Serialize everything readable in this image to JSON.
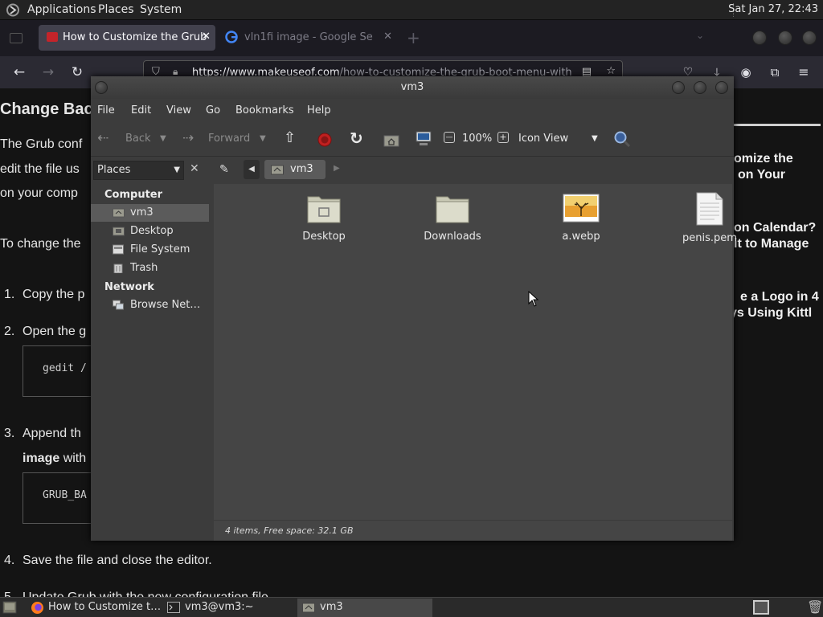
{
  "top_panel": {
    "menus": [
      "Applications",
      "Places",
      "System"
    ],
    "clock": "Sat Jan 27, 22:43"
  },
  "browser": {
    "tabs": [
      {
        "label": "How to Customize the Grub",
        "active": true
      },
      {
        "label": "vln1fi image - Google Se",
        "active": false
      }
    ],
    "url_domain": "https://www.makeuseof.com",
    "url_path": "/how-to-customize-the-grub-boot-menu-with",
    "page": {
      "heading": "Change Bac",
      "para_lines": [
        "The Grub conf",
        "edit the file us",
        "on your comp"
      ],
      "para2": "To change the",
      "list": [
        {
          "num": "1.",
          "text": "Copy the p"
        },
        {
          "num": "2.",
          "text": "Open the g"
        },
        {
          "num": "3.",
          "text": "Append th"
        },
        {
          "num": "4.",
          "text": "Save the file and close the editor."
        },
        {
          "num": "5.",
          "text": "Update Grub with the new configuration file"
        }
      ],
      "list3_line2_bold": "image",
      "list3_line2_rest": " with",
      "code1": "gedit /",
      "code2": "GRUB_BA",
      "sidebar_links": [
        [
          "omize the",
          "on Your"
        ],
        [
          "on Calendar?",
          "it to Manage"
        ],
        [
          "e a Logo in 4",
          "ys Using Kittl"
        ]
      ]
    }
  },
  "file_manager": {
    "title": "vm3",
    "menus": [
      "File",
      "Edit",
      "View",
      "Go",
      "Bookmarks",
      "Help"
    ],
    "toolbar": {
      "back": "Back",
      "forward": "Forward",
      "zoom": "100%",
      "view_mode": "Icon View"
    },
    "sidebar": {
      "combo": "Places",
      "computer_header": "Computer",
      "computer_items": [
        "vm3",
        "Desktop",
        "File System",
        "Trash"
      ],
      "network_header": "Network",
      "network_items": [
        "Browse Net…"
      ]
    },
    "path_button": "vm3",
    "files": [
      {
        "name": "Desktop",
        "icon": "folder-desktop-icon"
      },
      {
        "name": "Downloads",
        "icon": "folder-icon"
      },
      {
        "name": "a.webp",
        "icon": "image-thumbnail-icon"
      },
      {
        "name": "penis.pem",
        "icon": "text-file-icon"
      }
    ],
    "status": "4 items, Free space: 32.1 GB"
  },
  "bottom_panel": {
    "tasks": [
      {
        "label": "How to Customize t…",
        "active": false
      },
      {
        "label": "vm3@vm3:~",
        "active": false
      },
      {
        "label": "vm3",
        "active": true
      }
    ]
  }
}
